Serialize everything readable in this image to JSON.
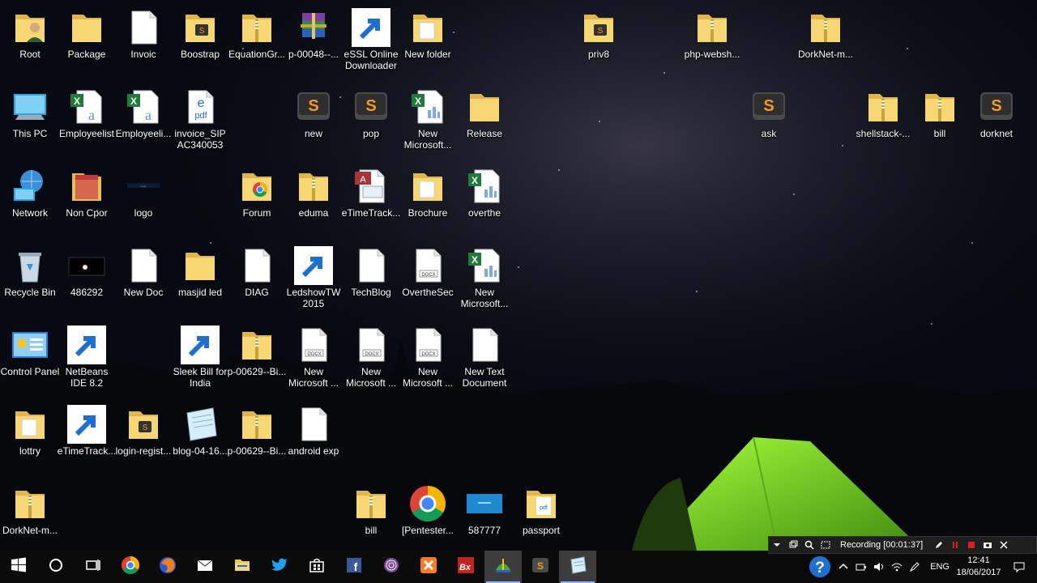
{
  "desktop": {
    "icons": [
      {
        "label": "Root",
        "kind": "folder-user"
      },
      {
        "label": "Package",
        "kind": "folder"
      },
      {
        "label": "Invoic",
        "kind": "doc"
      },
      {
        "label": "Boostrap",
        "kind": "folder-sublime"
      },
      {
        "label": "EquationGr...",
        "kind": "folder-zip"
      },
      {
        "label": "p-00048--...",
        "kind": "winrar"
      },
      {
        "label": "eSSL Online Downloader",
        "kind": "essl",
        "shortcut": true
      },
      {
        "label": "New folder",
        "kind": "folder-docs"
      },
      {
        "label": "priv8",
        "kind": "folder-sublime"
      },
      {
        "label": "php-websh...",
        "kind": "folder-zip"
      },
      {
        "label": "DorkNet-m...",
        "kind": "folder-zip"
      },
      {
        "label": "This PC",
        "kind": "pc"
      },
      {
        "label": "Employeelist",
        "kind": "excel-a"
      },
      {
        "label": "Employeeli...",
        "kind": "excel-a"
      },
      {
        "label": "invoice_SIP AC340053",
        "kind": "pdf"
      },
      {
        "label": "new",
        "kind": "sublime"
      },
      {
        "label": "pop",
        "kind": "sublime"
      },
      {
        "label": "New Microsoft...",
        "kind": "excel"
      },
      {
        "label": "Release",
        "kind": "folder"
      },
      {
        "label": "ask",
        "kind": "sublime"
      },
      {
        "label": "shellstack-...",
        "kind": "folder-zip"
      },
      {
        "label": "bill",
        "kind": "folder-zip"
      },
      {
        "label": "dorknet",
        "kind": "sublime"
      },
      {
        "label": "Network",
        "kind": "network"
      },
      {
        "label": "Non Cpor",
        "kind": "folder-red"
      },
      {
        "label": "logo",
        "kind": "logo"
      },
      {
        "label": "Forum",
        "kind": "folder-chrome"
      },
      {
        "label": "eduma",
        "kind": "folder-zip"
      },
      {
        "label": "eTimeTrack...",
        "kind": "access"
      },
      {
        "label": "Brochure",
        "kind": "folder-docs"
      },
      {
        "label": "overthe",
        "kind": "excel"
      },
      {
        "label": "Recycle Bin",
        "kind": "recycle"
      },
      {
        "label": "486292",
        "kind": "dark-image"
      },
      {
        "label": "New Doc",
        "kind": "doc"
      },
      {
        "label": "masjid led",
        "kind": "folder"
      },
      {
        "label": "DIAG",
        "kind": "doc"
      },
      {
        "label": "LedshowTW 2015",
        "kind": "bx",
        "shortcut": true
      },
      {
        "label": "TechBlog",
        "kind": "doc"
      },
      {
        "label": "OvertheSec",
        "kind": "docx"
      },
      {
        "label": "New Microsoft...",
        "kind": "excel"
      },
      {
        "label": "Control Panel",
        "kind": "control"
      },
      {
        "label": "NetBeans IDE 8.2",
        "kind": "netbeans",
        "shortcut": true
      },
      {
        "label": "Sleek Bill for India",
        "kind": "sleek",
        "shortcut": true
      },
      {
        "label": "p-00629--Bi...",
        "kind": "folder-zip"
      },
      {
        "label": "New Microsoft ...",
        "kind": "docx"
      },
      {
        "label": "New Microsoft ...",
        "kind": "docx"
      },
      {
        "label": "New Microsoft ...",
        "kind": "docx"
      },
      {
        "label": "New Text Document",
        "kind": "doc"
      },
      {
        "label": "lottry",
        "kind": "folder-docs"
      },
      {
        "label": "eTimeTrack...",
        "kind": "chart-app",
        "shortcut": true
      },
      {
        "label": "login-regist...",
        "kind": "folder-sublime"
      },
      {
        "label": "blog-04-16...",
        "kind": "notes"
      },
      {
        "label": "p-00629--Bi...",
        "kind": "folder-zip"
      },
      {
        "label": "android exp",
        "kind": "doc"
      },
      {
        "label": "DorkNet-m...",
        "kind": "folder-zip"
      },
      {
        "label": "bill",
        "kind": "folder-zip"
      },
      {
        "label": "[Pentester...",
        "kind": "chrome"
      },
      {
        "label": "587777",
        "kind": "blue-image"
      },
      {
        "label": "passport",
        "kind": "folder-pdf"
      }
    ]
  },
  "taskbar": {
    "items": [
      {
        "name": "start-button",
        "icon": "windows-icon"
      },
      {
        "name": "search-button",
        "icon": "cortana-icon"
      },
      {
        "name": "task-view-button",
        "icon": "task-view-icon"
      },
      {
        "name": "chrome-taskbar",
        "icon": "chrome-icon"
      },
      {
        "name": "firefox-taskbar",
        "icon": "firefox-icon"
      },
      {
        "name": "mail-taskbar",
        "icon": "mail-icon"
      },
      {
        "name": "explorer-taskbar",
        "icon": "folder-icon"
      },
      {
        "name": "twitter-taskbar",
        "icon": "twitter-icon"
      },
      {
        "name": "store-taskbar",
        "icon": "store-icon"
      },
      {
        "name": "facebook-taskbar",
        "icon": "facebook-icon"
      },
      {
        "name": "tor-taskbar",
        "icon": "tor-icon"
      },
      {
        "name": "xampp-taskbar",
        "icon": "xampp-icon"
      },
      {
        "name": "ledshow-taskbar",
        "icon": "bx-icon"
      },
      {
        "name": "downloader-taskbar",
        "icon": "downloader-icon",
        "active": true
      },
      {
        "name": "sublime-taskbar",
        "icon": "sublime-icon"
      },
      {
        "name": "notes-taskbar",
        "icon": "notes-icon",
        "active": true
      }
    ],
    "tray": {
      "language": "ENG",
      "time": "12:41",
      "date": "18/06/2017"
    }
  },
  "recorder": {
    "status": "Recording [00:01:37]"
  }
}
